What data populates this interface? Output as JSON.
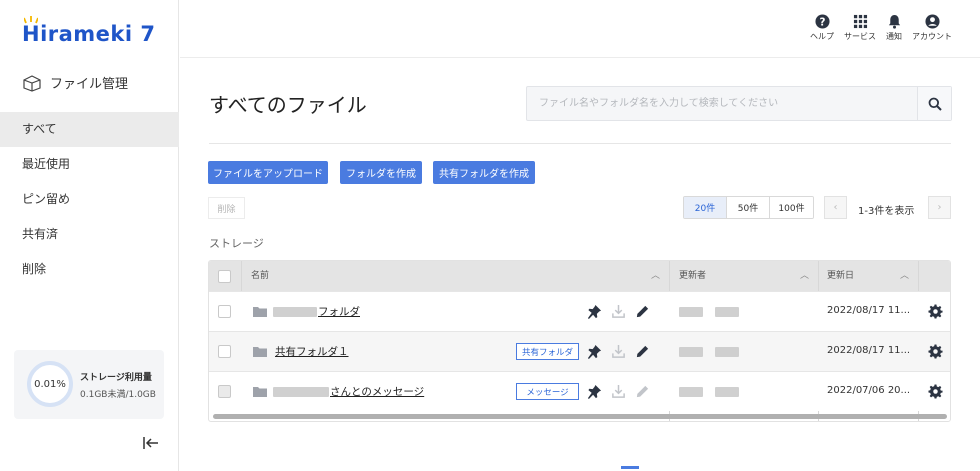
{
  "brand": {
    "logo_text": "Hirameki 7"
  },
  "sidebar": {
    "app_title": "ファイル管理",
    "items": [
      {
        "label": "すべて",
        "active": true
      },
      {
        "label": "最近使用"
      },
      {
        "label": "ピン留め"
      },
      {
        "label": "共有済"
      },
      {
        "label": "削除"
      }
    ],
    "storage": {
      "percent": "0.01%",
      "title": "ストレージ利用量",
      "usage": "0.1GB未満/1.0GB"
    }
  },
  "header": {
    "icons": [
      {
        "name": "help-icon",
        "label": "ヘルプ"
      },
      {
        "name": "services-icon",
        "label": "サービス"
      },
      {
        "name": "bell-icon",
        "label": "通知"
      },
      {
        "name": "account-icon",
        "label": "アカウント"
      }
    ]
  },
  "main": {
    "title": "すべてのファイル",
    "search": {
      "placeholder": "ファイル名やフォルダ名を入力して検索してください",
      "value": ""
    },
    "buttons": {
      "upload": "ファイルをアップロード",
      "create_folder": "フォルダを作成",
      "create_shared_folder": "共有フォルダを作成",
      "delete": "削除"
    },
    "per_page": {
      "options": [
        "20件",
        "50件",
        "100件"
      ],
      "selected": "20件"
    },
    "pagination_info": "1-3件を表示",
    "section_label": "ストレージ",
    "table": {
      "columns": {
        "name": "名前",
        "updater": "更新者",
        "updated_at": "更新日"
      },
      "rows": [
        {
          "name": "フォルダ",
          "tag": "",
          "date": "2022/08/17 11...",
          "edit_enabled": true,
          "checkbox_enabled": true
        },
        {
          "name": "共有フォルダ１",
          "tag": "共有フォルダ",
          "date": "2022/08/17 11...",
          "edit_enabled": true,
          "checkbox_enabled": true
        },
        {
          "name": "さんとのメッセージ",
          "tag": "メッセージ",
          "date": "2022/07/06 20...",
          "edit_enabled": false,
          "checkbox_enabled": false
        }
      ]
    }
  },
  "colors": {
    "accent": "#4a7be0",
    "brand": "#1f55c8",
    "icon_dark": "#2c3442"
  }
}
